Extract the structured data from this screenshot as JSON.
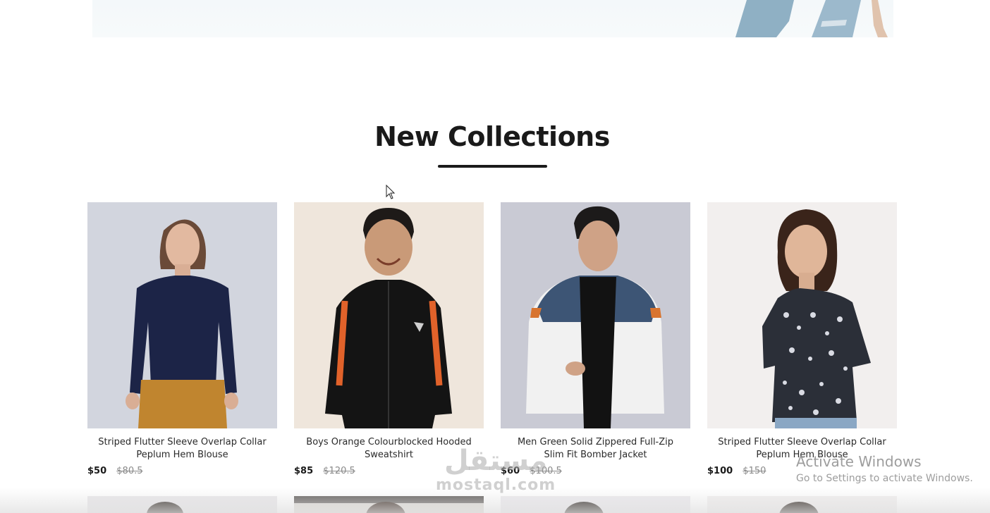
{
  "section": {
    "title": "New Collections"
  },
  "products": [
    {
      "name": "Striped Flutter Sleeve Overlap Collar Peplum Hem Blouse",
      "price": "$50",
      "old_price": "$80.5",
      "bg": "#d2d5de"
    },
    {
      "name": "Boys Orange Colourblocked Hooded Sweatshirt",
      "price": "$85",
      "old_price": "$120.5",
      "bg": "#efe6dc"
    },
    {
      "name": "Men Green Solid Zippered Full-Zip Slim Fit Bomber Jacket",
      "price": "$60",
      "old_price": "$100.5",
      "bg": "#c9cad4"
    },
    {
      "name": "Striped Flutter Sleeve Overlap Collar Peplum Hem Blouse",
      "price": "$100",
      "old_price": "$150",
      "bg": "#f2efee"
    }
  ],
  "watermark": {
    "arabic": "مستقل",
    "latin": "mostaql.com"
  },
  "os_overlay": {
    "title": "Activate Windows",
    "subtitle": "Go to Settings to activate Windows."
  }
}
